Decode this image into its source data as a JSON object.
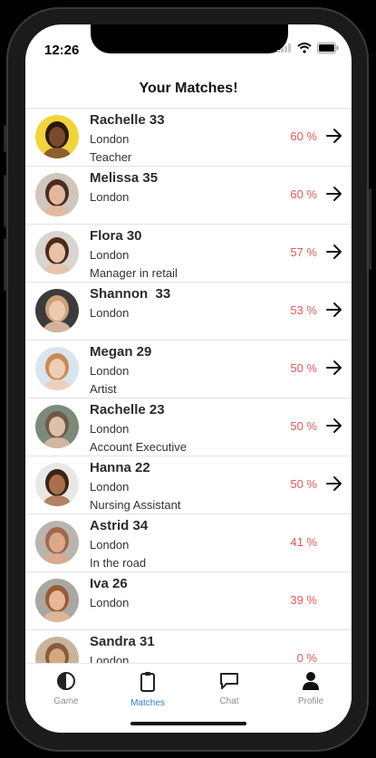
{
  "status": {
    "time": "12:26"
  },
  "header": {
    "title": "Your Matches!"
  },
  "matches": [
    {
      "name": "Rachelle 33",
      "city": "London",
      "job": "Teacher",
      "percent": "60 %",
      "arrow": true,
      "skin": "#7b4a2e",
      "hair": "#2a1a10",
      "bg": "#f2d43a"
    },
    {
      "name": "Melissa 35",
      "city": "London",
      "job": "",
      "percent": "60 %",
      "arrow": true,
      "skin": "#e3b79c",
      "hair": "#4a2c1e",
      "bg": "#cfc6bd"
    },
    {
      "name": "Flora 30",
      "city": "London",
      "job": "Manager in retail",
      "percent": "57 %",
      "arrow": true,
      "skin": "#e7c2a8",
      "hair": "#4b2b1a",
      "bg": "#d9d4cf"
    },
    {
      "name": "Shannon  33",
      "city": "London",
      "job": "",
      "percent": "53 %",
      "arrow": true,
      "skin": "#efc9ad",
      "hair": "#caa27a",
      "bg": "#3b3b3b"
    },
    {
      "name": "Megan 29",
      "city": "London",
      "job": "Artist",
      "percent": "50 %",
      "arrow": true,
      "skin": "#f0cdb5",
      "hair": "#c98b52",
      "bg": "#d8e4ee"
    },
    {
      "name": "Rachelle 23",
      "city": "London",
      "job": "Account Executive",
      "percent": "50 %",
      "arrow": true,
      "skin": "#dfc0a6",
      "hair": "#6f5a4a",
      "bg": "#7c8a7a"
    },
    {
      "name": "Hanna 22",
      "city": "London",
      "job": "Nursing Assistant",
      "percent": "50 %",
      "arrow": true,
      "skin": "#a8704a",
      "hair": "#3a2416",
      "bg": "#e8e8e8"
    },
    {
      "name": "Astrid 34",
      "city": "London",
      "job": "In the road",
      "percent": "41 %",
      "arrow": false,
      "skin": "#dba98a",
      "hair": "#a0674a",
      "bg": "#b9b4ae"
    },
    {
      "name": "Iva 26",
      "city": "London",
      "job": "",
      "percent": "39 %",
      "arrow": false,
      "skin": "#e6b896",
      "hair": "#9a5a36",
      "bg": "#a9a7a2"
    },
    {
      "name": "Sandra 31",
      "city": "London",
      "job": "",
      "percent": "0 %",
      "arrow": false,
      "skin": "#d7a87f",
      "hair": "#8a5a3a",
      "bg": "#c8b49a"
    }
  ],
  "tabs": [
    {
      "label": "Game",
      "icon": "half-circle-icon",
      "active": false
    },
    {
      "label": "Matches",
      "icon": "clipboard-icon",
      "active": true
    },
    {
      "label": "Chat",
      "icon": "chat-bubble-icon",
      "active": false
    },
    {
      "label": "Profile",
      "icon": "person-icon",
      "active": false
    }
  ],
  "colors": {
    "accent": "#2f7ed8",
    "percent": "#e8555a"
  }
}
